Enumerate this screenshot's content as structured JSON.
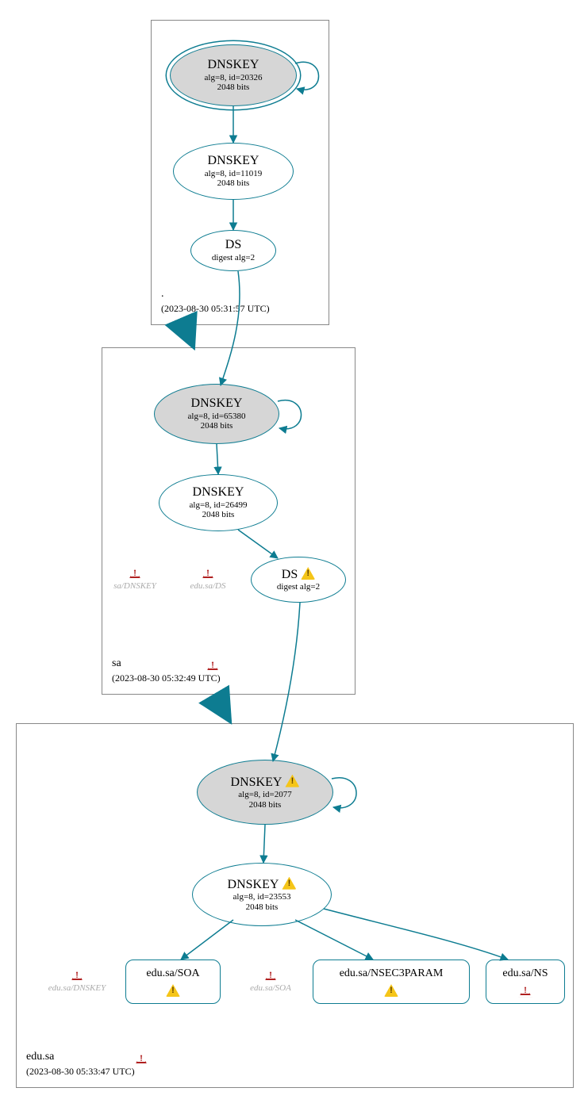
{
  "colors": {
    "stroke": "#0d7c91",
    "ksk_fill": "#d6d6d6",
    "box_border": "#888888"
  },
  "icons": {
    "warning_yellow": "warning-triangle-yellow",
    "warning_red": "warning-triangle-red"
  },
  "zone_root": {
    "name": ".",
    "timestamp": "(2023-08-30 05:31:57 UTC)",
    "ksk": {
      "title": "DNSKEY",
      "sub": "alg=8, id=20326",
      "bits": "2048 bits"
    },
    "zsk": {
      "title": "DNSKEY",
      "sub": "alg=8, id=11019",
      "bits": "2048 bits"
    },
    "ds": {
      "title": "DS",
      "sub": "digest alg=2"
    }
  },
  "zone_sa": {
    "name": "sa",
    "timestamp": "(2023-08-30 05:32:49 UTC)",
    "ksk": {
      "title": "DNSKEY",
      "sub": "alg=8, id=65380",
      "bits": "2048 bits"
    },
    "zsk": {
      "title": "DNSKEY",
      "sub": "alg=8, id=26499",
      "bits": "2048 bits"
    },
    "ds": {
      "title": "DS",
      "sub": "digest alg=2"
    },
    "errors": {
      "dnskey": "sa/DNSKEY",
      "edu_ds": "edu.sa/DS"
    }
  },
  "zone_edu": {
    "name": "edu.sa",
    "timestamp": "(2023-08-30 05:33:47 UTC)",
    "ksk": {
      "title": "DNSKEY",
      "sub": "alg=8, id=2077",
      "bits": "2048 bits"
    },
    "zsk": {
      "title": "DNSKEY",
      "sub": "alg=8, id=23553",
      "bits": "2048 bits"
    },
    "rr": {
      "soa": "edu.sa/SOA",
      "nsec3": "edu.sa/NSEC3PARAM",
      "ns": "edu.sa/NS"
    },
    "errors": {
      "dnskey": "edu.sa/DNSKEY",
      "soa": "edu.sa/SOA"
    }
  }
}
